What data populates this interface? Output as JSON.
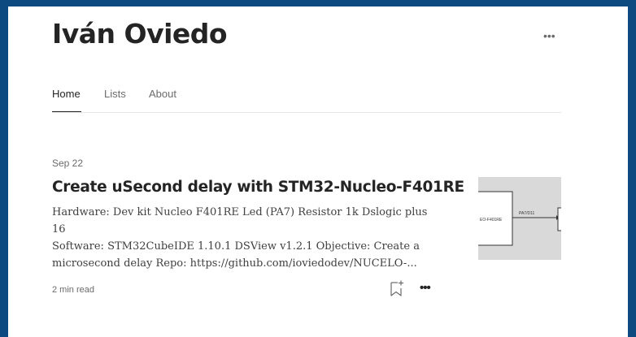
{
  "profile": {
    "name": "Iván Oviedo",
    "more_label": "•••"
  },
  "nav": {
    "tabs": [
      {
        "label": "Home",
        "active": true
      },
      {
        "label": "Lists",
        "active": false
      },
      {
        "label": "About",
        "active": false
      }
    ]
  },
  "post": {
    "date": "Sep 22",
    "title": "Create uSecond delay with STM32-Nucleo-F401RE",
    "excerpt": "Hardware: Dev kit Nucleo F401RE Led (PA7) Resistor 1k Dslogic plus 16\nSoftware: STM32CubeIDE 1.10.1 DSView v1.2.1 Objective: Create a\nmicrosecond delay Repo: https://github.com/ioviedodev/NUCELO-...",
    "read_time": "2 min read",
    "more_label": "•••",
    "thumbnail": {
      "left_label": "EO-F401RE",
      "pin_label": "PA7/D11"
    },
    "icons": {
      "bookmark": "bookmark-add-icon",
      "more": "more-horizontal-icon"
    }
  },
  "colors": {
    "outer_border": "#0d4a80",
    "text_primary": "#242424",
    "text_secondary": "#6b6b6b",
    "divider": "#e6e6e6",
    "thumbnail_bg": "#d9d9d9"
  }
}
